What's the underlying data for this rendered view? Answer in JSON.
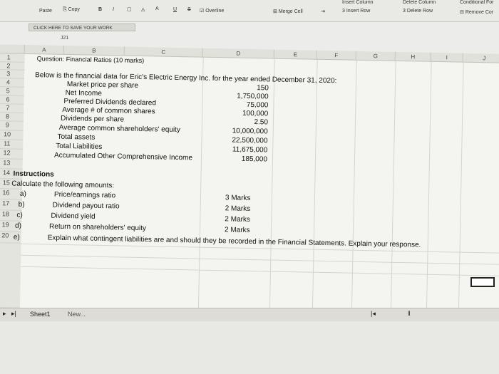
{
  "toolbar": {
    "paste": "Paste",
    "copy": "Copy",
    "bold": "B",
    "italic": "I",
    "underline": "U",
    "strike": "S",
    "overline": "Overline",
    "merge_cell": "Merge Cell",
    "insert_column": "Insert Column",
    "insert_row": "Insert Row",
    "delete_column": "Delete Column",
    "delete_row": "Delete Row",
    "conditional_format": "Conditional For",
    "remove": "Remove Cor"
  },
  "save_bar": "CLICK HERE TO SAVE YOUR WORK",
  "name_box": "J21",
  "columns": [
    "A",
    "B",
    "C",
    "D",
    "E",
    "F",
    "G",
    "H",
    "I",
    "J"
  ],
  "rows": {
    "r1": {
      "num": "1",
      "text": "Question: Financial Ratios (10 marks)"
    },
    "r2": {
      "num": "2"
    },
    "r3": {
      "num": "3",
      "text": "Below is the financial data for Eric's Electric Energy Inc. for the year ended December 31, 2020:"
    },
    "r4": {
      "num": "4",
      "label": "Market price per share",
      "value": "150"
    },
    "r5": {
      "num": "5",
      "label": "Net Income",
      "value": "1,750,000"
    },
    "r6": {
      "num": "6",
      "label": "Preferred Dividends declared",
      "value": "75,000"
    },
    "r7": {
      "num": "7",
      "label": "Average # of common shares",
      "value": "100,000"
    },
    "r8": {
      "num": "8",
      "label": "Dividends per share",
      "value": "2.50"
    },
    "r9": {
      "num": "9",
      "label": "Average common shareholders' equity",
      "value": "10,000,000"
    },
    "r10": {
      "num": "10",
      "label": "Total assets",
      "value": "22,500,000"
    },
    "r11": {
      "num": "11",
      "label": "Total Liabilities",
      "value": "11,675,000"
    },
    "r12": {
      "num": "12",
      "label": "Accumulated Other Comprehensive Income",
      "value": "185,000"
    },
    "r13": {
      "num": "13"
    },
    "r14": {
      "num": "14",
      "text": "Instructions"
    },
    "r15": {
      "num": "15",
      "text": "Calculate the following amounts:"
    },
    "r16": {
      "num": "16",
      "letter": "a)",
      "label": "Price/earnings ratio",
      "marks": "3 Marks"
    },
    "r17": {
      "num": "17",
      "letter": "b)",
      "label": "Dividend payout ratio",
      "marks": "2 Marks"
    },
    "r18": {
      "num": "18",
      "letter": "c)",
      "label": "Dividend yield",
      "marks": "2 Marks"
    },
    "r19": {
      "num": "19",
      "letter": "d)",
      "label": "Return on shareholders' equity",
      "marks": "2 Marks"
    },
    "r20": {
      "num": "20",
      "letter": "e)",
      "label": "Explain what contingent liabilities are and should they be recorded in the Financial Statements. Explain your response."
    }
  },
  "tabs": {
    "sheet1": "Sheet1",
    "new": "New..."
  },
  "colors": {
    "toolbar": "#e9e9e6",
    "sheet": "#f4f4f1",
    "header": "#e1e1dc"
  }
}
